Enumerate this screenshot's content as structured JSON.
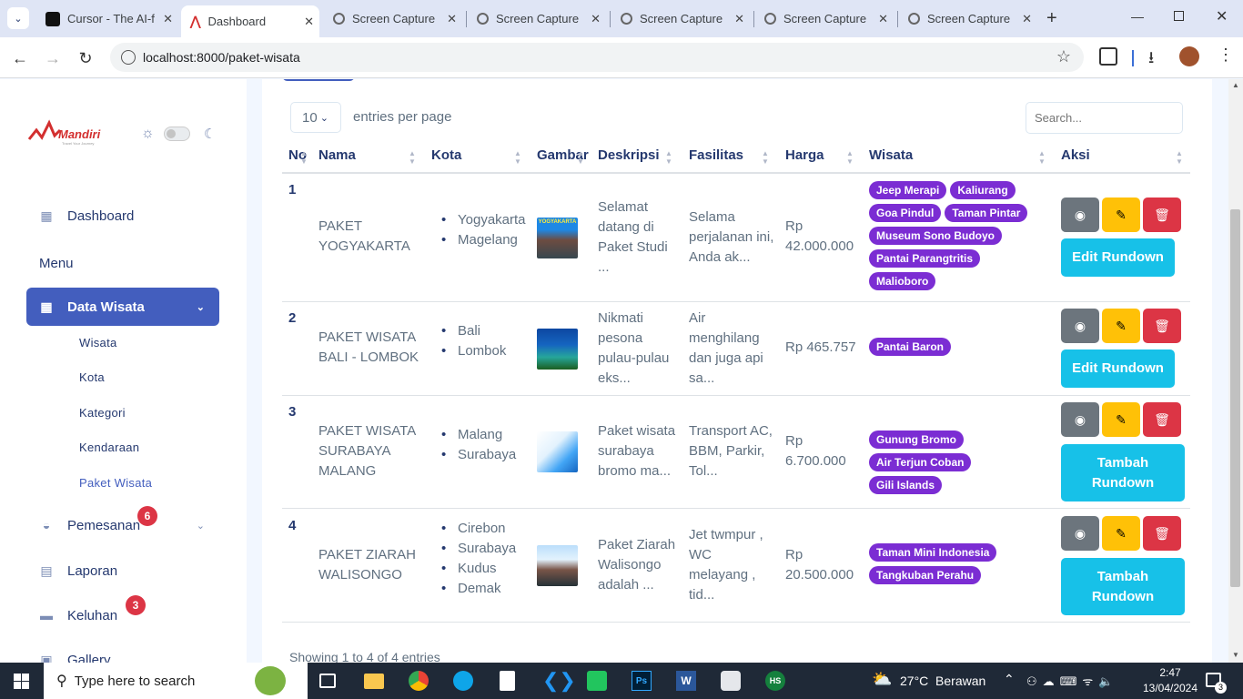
{
  "browser": {
    "tabs": [
      {
        "title": "Cursor - The AI-f",
        "icon": "cursor-icon"
      },
      {
        "title": "Dashboard",
        "icon": "mandiri-icon",
        "active": true
      },
      {
        "title": "Screen Capture |",
        "icon": "screen-capture-icon"
      },
      {
        "title": "Screen Capture |",
        "icon": "screen-capture-icon"
      },
      {
        "title": "Screen Capture |",
        "icon": "screen-capture-icon"
      },
      {
        "title": "Screen Capture |",
        "icon": "screen-capture-icon"
      },
      {
        "title": "Screen Capture |",
        "icon": "screen-capture-icon"
      }
    ],
    "url": "localhost:8000/paket-wisata"
  },
  "sidebar": {
    "logo": "Mandiri",
    "logo_tagline": "Travel Your Journey",
    "items": [
      {
        "label": "Dashboard",
        "icon": "grid-icon"
      },
      {
        "label": "Menu"
      },
      {
        "label": "Data Wisata",
        "icon": "grid-icon"
      }
    ],
    "subitems": [
      "Wisata",
      "Kota",
      "Kategori",
      "Kendaraan",
      "Paket Wisata"
    ],
    "lower_items": [
      {
        "label": "Pemesanan",
        "badge": "6",
        "icon": "basket-icon"
      },
      {
        "label": "Laporan",
        "icon": "clipboard-icon"
      },
      {
        "label": "Keluhan",
        "badge": "3",
        "icon": "chat-icon"
      },
      {
        "label": "Gallery",
        "icon": "image-icon"
      }
    ]
  },
  "table": {
    "entries_value": "10",
    "entries_label": "entries per page",
    "search_placeholder": "Search...",
    "headers": [
      "No",
      "Nama",
      "Kota",
      "Gambar",
      "Deskripsi",
      "Fasilitas",
      "Harga",
      "Wisata",
      "Aksi"
    ],
    "rows": [
      {
        "no": "1",
        "nama": [
          "PAKET",
          "YOGYAKARTA"
        ],
        "kota": [
          "Yogyakarta",
          "Magelang"
        ],
        "deskripsi": [
          "Selamat",
          "datang di",
          "Paket Studi",
          "..."
        ],
        "fasilitas": [
          "Selama",
          "perjalanan ini,",
          "Anda ak..."
        ],
        "harga": [
          "Rp",
          "42.000.000"
        ],
        "wisata": [
          "Jeep Merapi",
          "Kaliurang",
          "Goa Pindul",
          "Taman Pintar",
          "Museum Sono Budoyo",
          "Pantai Parangtritis",
          "Malioboro"
        ],
        "rundown": [
          "Edit Rundown"
        ]
      },
      {
        "no": "2",
        "nama": [
          "PAKET WISATA",
          "BALI - LOMBOK"
        ],
        "kota": [
          "Bali",
          "Lombok"
        ],
        "deskripsi": [
          "Nikmati",
          "pesona",
          "pulau-pulau",
          "eks..."
        ],
        "fasilitas": [
          "Air",
          "menghilang",
          "dan juga api",
          "sa..."
        ],
        "harga": [
          "Rp 465.757"
        ],
        "wisata": [
          "Pantai Baron"
        ],
        "rundown": [
          "Edit Rundown"
        ]
      },
      {
        "no": "3",
        "nama": [
          "PAKET WISATA",
          "SURABAYA",
          "MALANG"
        ],
        "kota": [
          "Malang",
          "Surabaya"
        ],
        "deskripsi": [
          "Paket wisata",
          "surabaya",
          "bromo ma..."
        ],
        "fasilitas": [
          "Transport AC,",
          "BBM, Parkir,",
          "Tol..."
        ],
        "harga": [
          "Rp",
          "6.700.000"
        ],
        "wisata": [
          "Gunung Bromo",
          "Air Terjun Coban",
          "Gili Islands"
        ],
        "rundown": [
          "Tambah",
          "Rundown"
        ]
      },
      {
        "no": "4",
        "nama": [
          "PAKET ZIARAH",
          "WALISONGO"
        ],
        "kota": [
          "Cirebon",
          "Surabaya",
          "Kudus",
          "Demak"
        ],
        "deskripsi": [
          "Paket Ziarah",
          "Walisongo",
          "adalah ..."
        ],
        "fasilitas": [
          "Jet twmpur ,",
          "WC",
          "melayang ,",
          "tid..."
        ],
        "harga": [
          "Rp",
          "20.500.000"
        ],
        "wisata": [
          "Taman Mini Indonesia",
          "Tangkuban Perahu"
        ],
        "rundown": [
          "Tambah",
          "Rundown"
        ]
      }
    ],
    "footer": "Showing 1 to 4 of 4 entries"
  },
  "taskbar": {
    "search_placeholder": "Type here to search",
    "weather": "27°C  Berawan",
    "time": "2:47",
    "date": "13/04/2024",
    "notifications": "3"
  },
  "colors": {
    "primary": "#435ebe",
    "pill": "#7b2dd3",
    "rundown": "#17c1e8",
    "danger": "#dc3545",
    "warning": "#ffc107"
  }
}
